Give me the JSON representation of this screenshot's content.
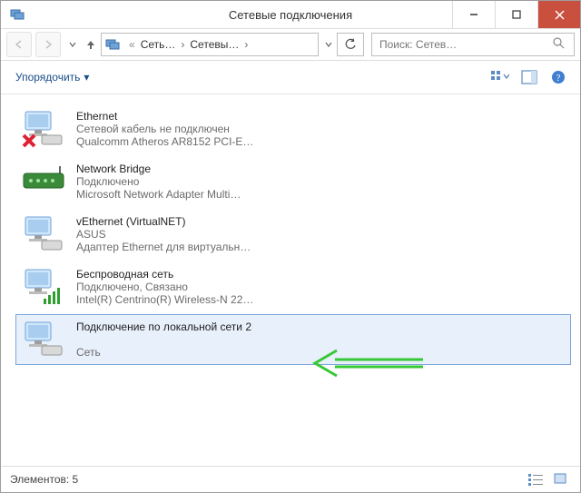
{
  "window": {
    "title": "Сетевые подключения"
  },
  "breadcrumb": {
    "seg1": "Сеть…",
    "seg2": "Сетевы…"
  },
  "search": {
    "placeholder": "Поиск: Сетев…"
  },
  "toolbar": {
    "organize": "Упорядочить"
  },
  "items": [
    {
      "name": "Ethernet",
      "status": "Сетевой кабель не подключен",
      "device": "Qualcomm Atheros AR8152 PCI-E…",
      "icon": "nic-disconnected"
    },
    {
      "name": "Network Bridge",
      "status": "Подключено",
      "device": "Microsoft Network Adapter Multi…",
      "icon": "bridge"
    },
    {
      "name": "vEthernet (VirtualNET)",
      "status": "ASUS",
      "device": "Адаптер Ethernet для виртуальн…",
      "icon": "nic"
    },
    {
      "name": "Беспроводная сеть",
      "status": "Подключено, Связано",
      "device": "Intel(R) Centrino(R) Wireless-N 22…",
      "icon": "wifi"
    },
    {
      "name": "Подключение по локальной сети 2",
      "status": "",
      "device": "Сеть",
      "icon": "nic",
      "selected": true
    }
  ],
  "statusbar": {
    "label": "Элементов:",
    "count": "5"
  }
}
